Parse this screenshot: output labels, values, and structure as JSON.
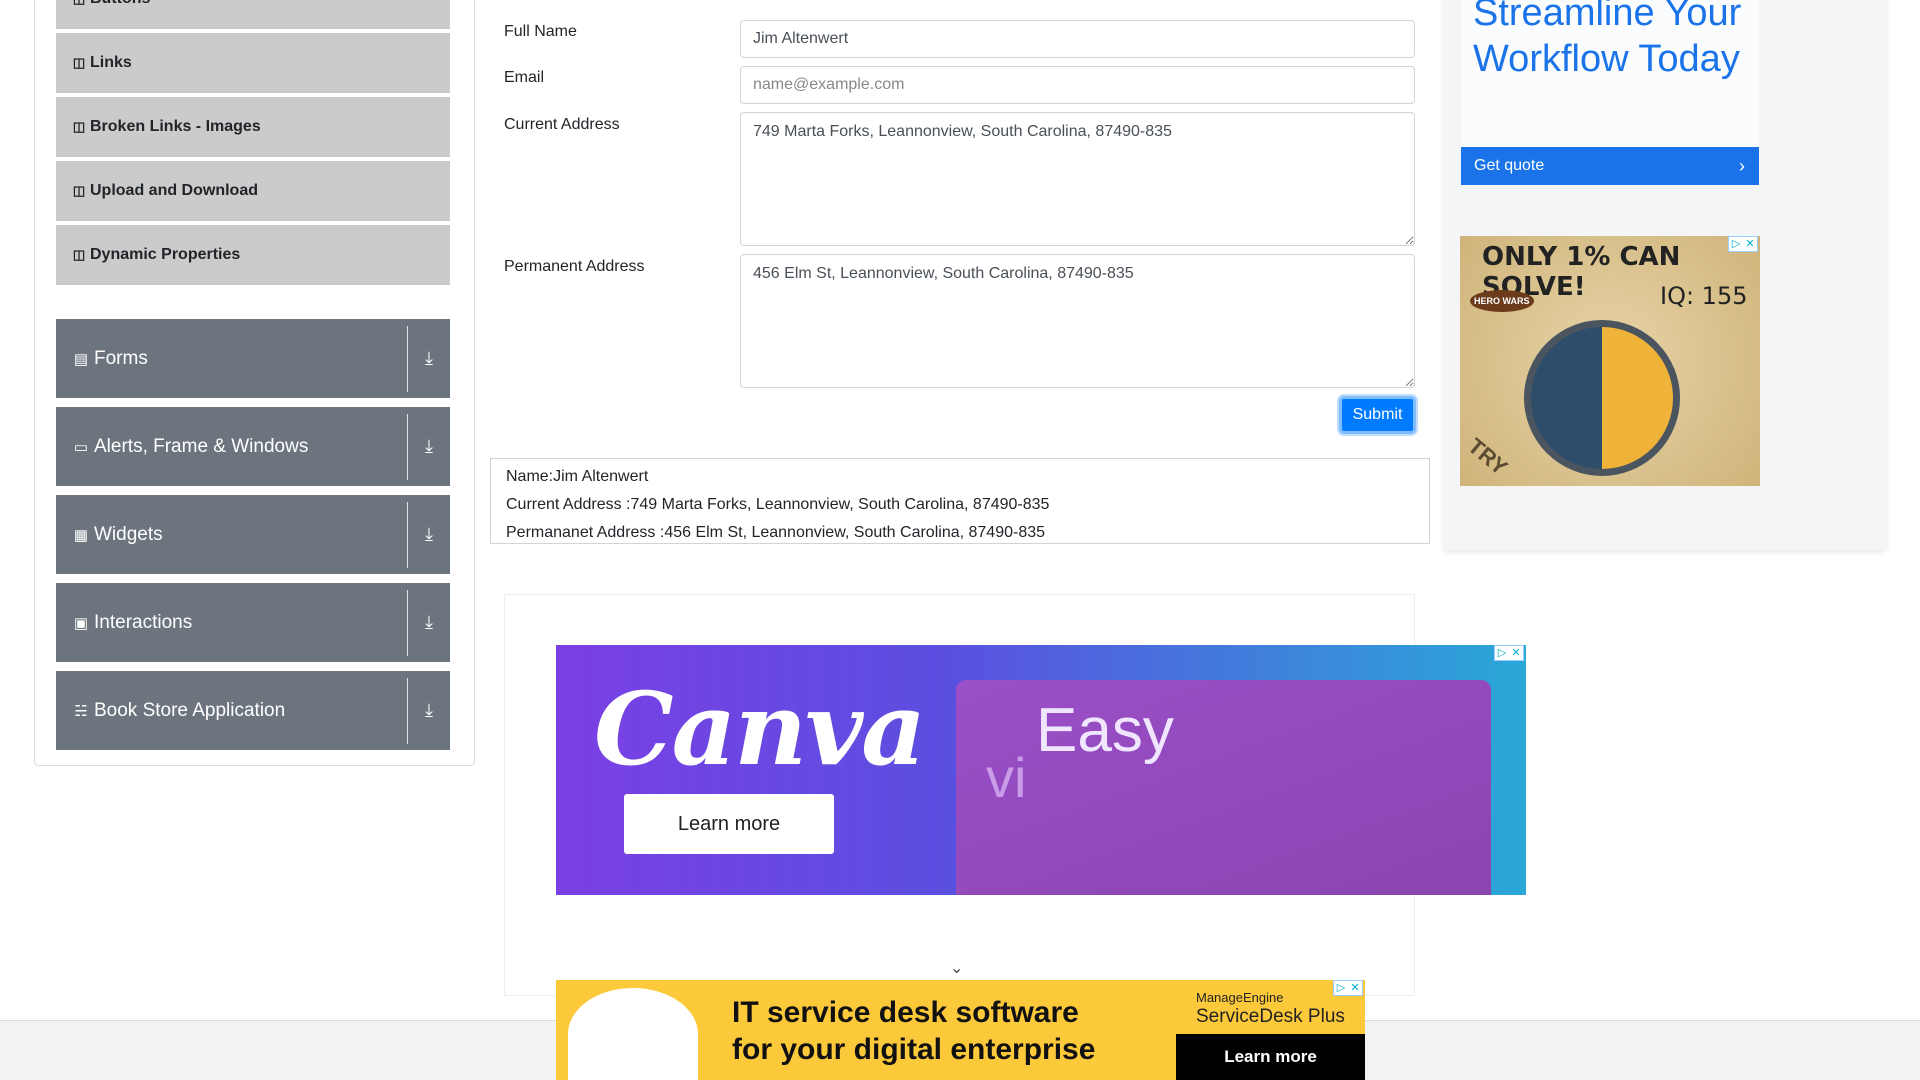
{
  "sidebar": {
    "sub_items": [
      {
        "label": "Buttons",
        "icon": "html5-icon"
      },
      {
        "label": "Links",
        "icon": "html5-icon"
      },
      {
        "label": "Broken Links - Images",
        "icon": "html5-icon"
      },
      {
        "label": "Upload and Download",
        "icon": "html5-icon"
      },
      {
        "label": "Dynamic Properties",
        "icon": "html5-icon"
      }
    ],
    "groups": [
      {
        "label": "Forms",
        "icon": "form-icon"
      },
      {
        "label": "Alerts, Frame & Windows",
        "icon": "window-icon"
      },
      {
        "label": "Widgets",
        "icon": "widgets-icon"
      },
      {
        "label": "Interactions",
        "icon": "interactions-icon"
      },
      {
        "label": "Book Store Application",
        "icon": "books-icon"
      }
    ]
  },
  "form": {
    "full_name_label": "Full Name",
    "full_name_value": "Jim Altenwert",
    "email_label": "Email",
    "email_placeholder": "name@example.com",
    "current_address_label": "Current Address",
    "current_address_value": "749 Marta Forks, Leannonview, South Carolina, 87490-835",
    "permanent_address_label": "Permanent Address",
    "permanent_address_value": "456 Elm St, Leannonview, South Carolina, 87490-835",
    "submit_label": "Submit"
  },
  "output": {
    "name": "Name:Jim Altenwert",
    "current_address": "Current Address :749 Marta Forks, Leannonview, South Carolina, 87490-835",
    "permanent_address": "Permananet Address :456 Elm St, Leannonview, South Carolina, 87490-835"
  },
  "ads": {
    "workflow_title": "Streamline Your Workflow Today",
    "workflow_cta": "Get quote",
    "game_headline": "ONLY 1% CAN SOLVE!",
    "game_iq": "IQ: 155",
    "game_brand": "HERO WARS",
    "game_try": "TRY",
    "canva_logo": "Canva",
    "canva_cta": "Learn more",
    "canva_easy": "Easy",
    "canva_vi": "vi",
    "it_headline_1": "IT service desk software",
    "it_headline_2": "for your digital enterprise",
    "it_brand_1": "ManageEngine",
    "it_brand_2": "ServiceDesk Plus",
    "it_cta": "Learn more"
  },
  "colors": {
    "primary": "#007bff",
    "group_bg": "#6c757d",
    "sub_item_bg": "#cbcbcb"
  }
}
